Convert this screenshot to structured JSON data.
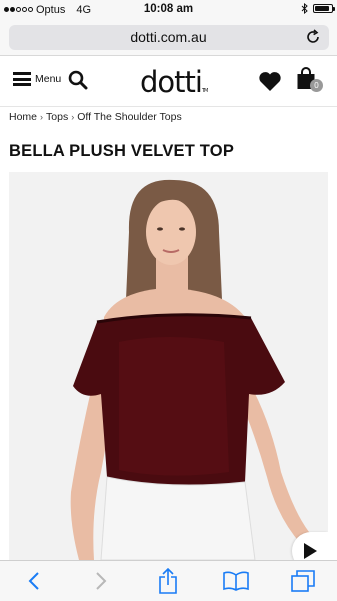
{
  "status_bar": {
    "carrier": "Optus",
    "network": "4G",
    "time": "10:08 am",
    "signal_bars_filled": 2,
    "signal_bars_total": 5,
    "battery_level": 0.85
  },
  "browser": {
    "url": "dotti.com.au"
  },
  "header": {
    "menu_label": "Menu",
    "logo_text": "dotti",
    "logo_tm": "TM",
    "cart_count": "0"
  },
  "breadcrumb": {
    "items": [
      "Home",
      "Tops",
      "Off The Shoulder Tops"
    ],
    "separator": "›"
  },
  "product": {
    "title": "BELLA PLUSH VELVET TOP"
  },
  "colors": {
    "accent_text": "#111111",
    "top_color": "#4a0b10",
    "badge": "#999999",
    "ios_blue": "#1a7cf5"
  },
  "icons": {
    "search": "search-icon",
    "heart": "heart-icon",
    "bag": "shopping-bag-icon",
    "reload": "reload-icon",
    "next": "play-arrow-icon"
  }
}
